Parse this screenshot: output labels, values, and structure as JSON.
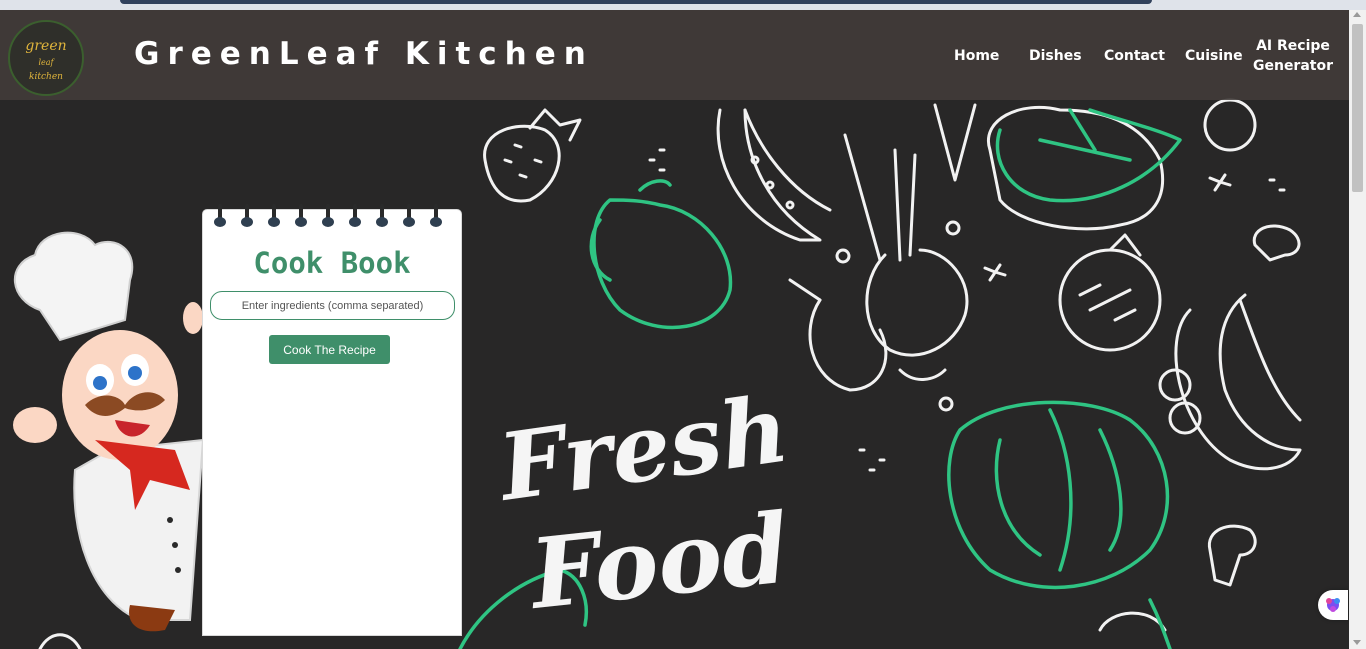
{
  "logo": {
    "line1": "green",
    "line2": "leaf",
    "line3": "kitchen"
  },
  "site_title": "GreenLeaf Kitchen",
  "nav": {
    "home": "Home",
    "dishes": "Dishes",
    "contact": "Contact",
    "cuisine": "Cuisine",
    "ai_line1": "AI Recipe",
    "ai_line2": "Generator"
  },
  "hero": {
    "word1": "Fresh",
    "word2": "Food"
  },
  "cookbook": {
    "title": "Cook Book",
    "input_placeholder": "Enter ingredients (comma separated)",
    "button_label": "Cook The Recipe"
  },
  "colors": {
    "accent": "#3f8f6a",
    "nav_bg": "#423c3a",
    "page_bg": "#282727",
    "doodle_green": "#2fc483",
    "logo_gold": "#e0b53c"
  },
  "icons": [
    "chef-mascot",
    "vegetable-doodles",
    "floating-widget-icon"
  ]
}
